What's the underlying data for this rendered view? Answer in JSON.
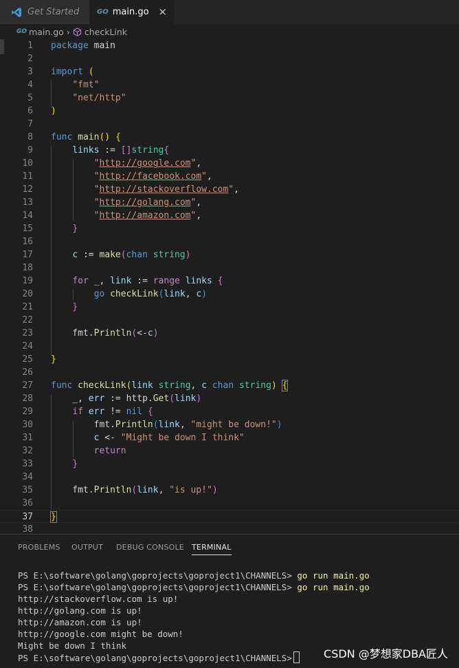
{
  "tabs": [
    {
      "label": "Get Started",
      "icon": "vscode-icon"
    },
    {
      "label": "main.go",
      "icon": "go-file-icon",
      "close": "×"
    }
  ],
  "go_glyph": "GO",
  "breadcrumb": {
    "file": "main.go",
    "separator": "›",
    "symbol": "checkLink"
  },
  "code": {
    "lines": [
      "package main",
      "",
      "import (",
      "    \"fmt\"",
      "    \"net/http\"",
      ")",
      "",
      "func main() {",
      "    links := []string{",
      "        \"http://google.com\",",
      "        \"http://facebook.com\",",
      "        \"http://stackoverflow.com\",",
      "        \"http://golang.com\",",
      "        \"http://amazon.com\",",
      "    }",
      "",
      "    c := make(chan string)",
      "",
      "    for _, link := range links {",
      "        go checkLink(link, c)",
      "    }",
      "",
      "    fmt.Println(<-c)",
      "",
      "}",
      "",
      "func checkLink(link string, c chan string) {",
      "    _, err := http.Get(link)",
      "    if err != nil {",
      "        fmt.Println(link, \"might be down!\")",
      "        c <- \"Might be down I think\"",
      "        return",
      "    }",
      "",
      "    fmt.Println(link, \"is up!\")",
      "",
      "}",
      ""
    ],
    "active_line": 37
  },
  "panel": {
    "tabs": [
      "PROBLEMS",
      "OUTPUT",
      "DEBUG CONSOLE",
      "TERMINAL"
    ],
    "active_tab": "TERMINAL"
  },
  "terminal": {
    "prompt": "PS E:\\software\\golang\\goprojects\\goproject1\\CHANNELS>",
    "command": "go run main.go",
    "output": [
      "http://stackoverflow.com is up!",
      "http://golang.com is up!",
      "http://amazon.com is up!",
      "http://google.com might be down!",
      "Might be down I think"
    ]
  },
  "watermark": "CSDN @梦想家DBA匠人",
  "colors": {
    "keyword": "#569cd6",
    "control": "#c586c0",
    "function": "#dcdcaa",
    "string": "#ce9178",
    "variable": "#9cdcfe",
    "type": "#4ec9b0",
    "background": "#1e1e1e"
  }
}
